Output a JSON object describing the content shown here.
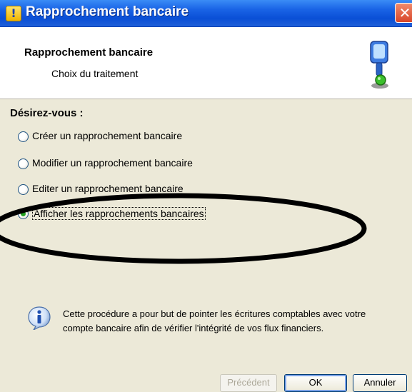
{
  "window": {
    "title": "Rapprochement bancaire"
  },
  "header": {
    "title": "Rapprochement bancaire",
    "subtitle": "Choix du traitement"
  },
  "question": "Désirez-vous :",
  "options": [
    {
      "label": "Créer un rapprochement bancaire",
      "checked": false
    },
    {
      "label": "Modifier un rapprochement bancaire",
      "checked": false
    },
    {
      "label": "Editer un rapprochement bancaire",
      "checked": false
    },
    {
      "label": "Afficher les rapprochements bancaires",
      "checked": true
    }
  ],
  "info": {
    "text": "Cette procédure a pour but de pointer les écritures comptables avec votre compte bancaire afin de vérifier l'intégrité de vos flux financiers."
  },
  "buttons": {
    "previous": "Précédent",
    "ok": "OK",
    "cancel": "Annuler"
  },
  "colors": {
    "titlebar": "#0a4fd6",
    "dialog_bg": "#ece9d8",
    "radio_dot": "#21a121"
  }
}
